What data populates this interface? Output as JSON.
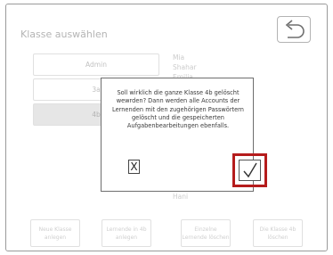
{
  "header": {
    "title": "Klasse auswählen",
    "back_icon": "undo-arrow-icon"
  },
  "classes": [
    {
      "label": "Admin"
    },
    {
      "label": "3a"
    },
    {
      "label": "4b"
    }
  ],
  "students": [
    "Mia",
    "Shahar",
    "Emilia",
    "Hani"
  ],
  "bottom_buttons": [
    {
      "label": "Neue Klasse\nanlegen"
    },
    {
      "label": "Lernende in 4b\nanlegen"
    },
    {
      "label": "Einzelne\nLernende löschen"
    },
    {
      "label": "Die Klasse 4b\nlöschen"
    }
  ],
  "dialog": {
    "message": "Soll wirklich die ganze Klasse 4b gelöscht wewrden? Dann werden alle Accounts der Lernenden mit den zugehörigen Passwörtern gelöscht und die gespeicherten Aufgabenbearbeitungen ebenfalls.",
    "cancel_label": "X",
    "confirm_icon": "checkmark-icon"
  },
  "colors": {
    "highlight": "#b51c1c",
    "selected_class_bg": "#d9d9d9"
  }
}
